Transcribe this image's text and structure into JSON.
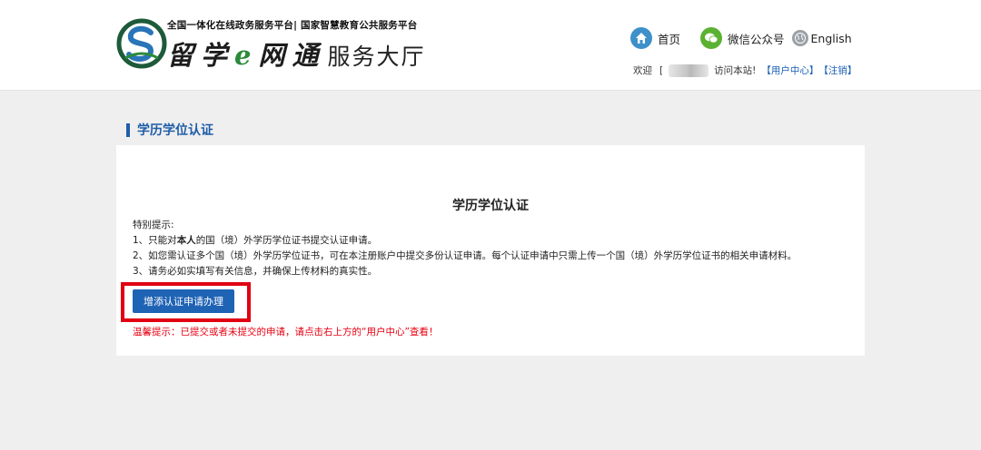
{
  "header": {
    "logo_subtitle": "全国一体化在线政务服务平台| 国家智慧教育公共服务平台",
    "logo_brand_a": "留学",
    "logo_brand_e": "e",
    "logo_brand_b": "网通",
    "logo_hall": "服务大厅",
    "nav": {
      "home": "首页",
      "wechat": "微信公众号",
      "english": "English"
    },
    "welcome": {
      "prefix": "欢迎",
      "bracket_open": "[",
      "suffix": "访问本站!",
      "user_center": "【用户中心】",
      "logout": "【注销】"
    }
  },
  "section": {
    "title": "学历学位认证"
  },
  "card": {
    "title": "学历学位认证",
    "notice_heading": "特别提示:",
    "notice_1_before": "1、只能对",
    "notice_1_bold": "本人",
    "notice_1_after": "的国（境）外学历学位证书提交认证申请。",
    "notice_2": "2、如您需认证多个国（境）外学历学位证书，可在本注册账户中提交多份认证申请。每个认证申请中只需上传一个国（境）外学历学位证书的相关申请材料。",
    "notice_3": "3、请务必如实填写有关信息，并确保上传材料的真实性。",
    "add_button": "增添认证申请办理",
    "warm_tip": "温馨提示：已提交或者未提交的申请，请点击右上方的“用户中心”查看！"
  },
  "colors": {
    "accent": "#1f5da8",
    "button": "#1f63b5",
    "highlight": "#e00012",
    "warning": "#e60012"
  }
}
